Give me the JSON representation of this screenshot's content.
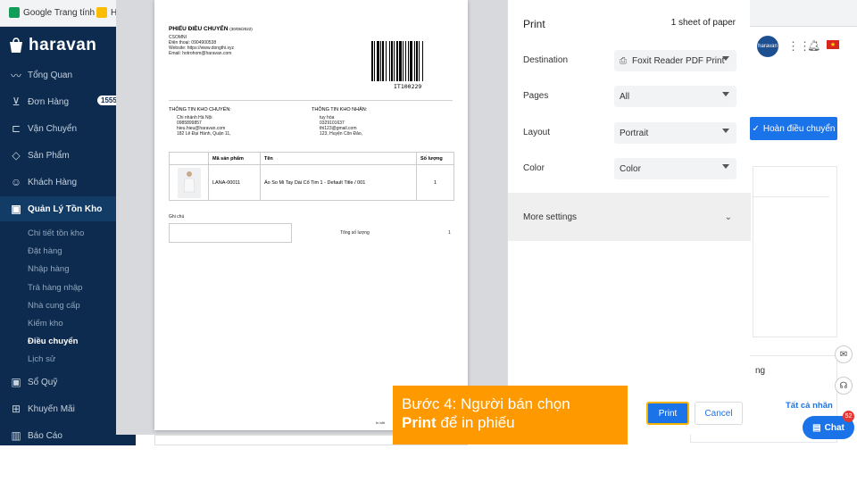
{
  "bookmarks": [
    {
      "label": "Google Trang tính",
      "color": "#0f9d58"
    },
    {
      "label": "H",
      "color": "#fbbc04"
    }
  ],
  "brand": {
    "name": "haravan"
  },
  "sidebar": {
    "items": [
      {
        "label": "Tổng Quan",
        "icon": "chart-line-icon",
        "glyph": "〰"
      },
      {
        "label": "Đơn Hàng",
        "icon": "cart-icon",
        "glyph": "🛒",
        "badge": "1555"
      },
      {
        "label": "Vận Chuyển",
        "icon": "truck-icon",
        "glyph": "⛟"
      },
      {
        "label": "Sản Phẩm",
        "icon": "tag-icon",
        "glyph": "◇"
      },
      {
        "label": "Khách Hàng",
        "icon": "user-icon",
        "glyph": "☺"
      },
      {
        "label": "Quản Lý Tồn Kho",
        "icon": "inventory-icon",
        "glyph": "▣"
      }
    ],
    "sub_items": [
      "Chi tiết tồn kho",
      "Đặt hàng",
      "Nhập hàng",
      "Trả hàng nhập",
      "Nhà cung cấp",
      "Kiểm kho",
      "Điều chuyển",
      "Lịch sử"
    ],
    "bottom_items": [
      {
        "label": "Sổ Quỹ",
        "icon": "cashbook-icon",
        "glyph": "▣"
      },
      {
        "label": "Khuyến Mãi",
        "icon": "gift-icon",
        "glyph": "🎁"
      },
      {
        "label": "Báo Cáo",
        "icon": "report-icon",
        "glyph": "▥"
      }
    ]
  },
  "header_right": {
    "avatar_text": "haravan",
    "complete_button": "Hoàn điều chuyển"
  },
  "panel": {
    "letter": "ng",
    "see_all": "Tất cả nhãn"
  },
  "chat": {
    "label": "Chat",
    "count": "52"
  },
  "document": {
    "title": "PHIẾU ĐIỀU CHUYỂN",
    "date": "(30/05/2022)",
    "store_lines": [
      "CSOMNI",
      "Điện thoại: 0904900538",
      "Website: https://www.dongthi.xyz",
      "Email: hotrohom@haravan.com"
    ],
    "barcode_text": "IT100229",
    "from_heading": "THÔNG TIN KHO CHUYỂN:",
    "from_lines": [
      "Chi nhánh Hà Nội",
      "0985899857",
      "hieu.hieu@haravan.com",
      "182 Lê Đại Hành, Quận 11,"
    ],
    "to_heading": "THÔNG TIN KHO NHẬN:",
    "to_lines": [
      "tuy hòa",
      "0329101637",
      "thi123@gmail.com",
      "123, Huyện Côn Đảo,"
    ],
    "table_headers": [
      "",
      "Mã sản phẩm",
      "Tên",
      "Số lượng"
    ],
    "rows": [
      {
        "sku": "LANA-00011",
        "name": "Áo So Mi Tay Dài Cổ Tim 1 - Default Title / 001",
        "qty": "1"
      }
    ],
    "note_label": "Ghi chú",
    "total_label": "Tổng số lượng",
    "total_value": "1",
    "footer_text": "In bởi"
  },
  "print": {
    "title": "Print",
    "sheets": "1 sheet of paper",
    "destination_label": "Destination",
    "destination_value": "Foxit Reader PDF Print",
    "pages_label": "Pages",
    "pages_value": "All",
    "layout_label": "Layout",
    "layout_value": "Portrait",
    "color_label": "Color",
    "color_value": "Color",
    "more_settings": "More settings",
    "print_button": "Print",
    "cancel_button": "Cancel"
  },
  "callout": {
    "line1": "Bước 4: Người bán chọn",
    "bold": "Print",
    "line2_rest": " để in phiếu"
  },
  "colors": {
    "sidebar": "#0d2b4e",
    "accent": "#1a73e8",
    "callout": "#ff9900"
  }
}
